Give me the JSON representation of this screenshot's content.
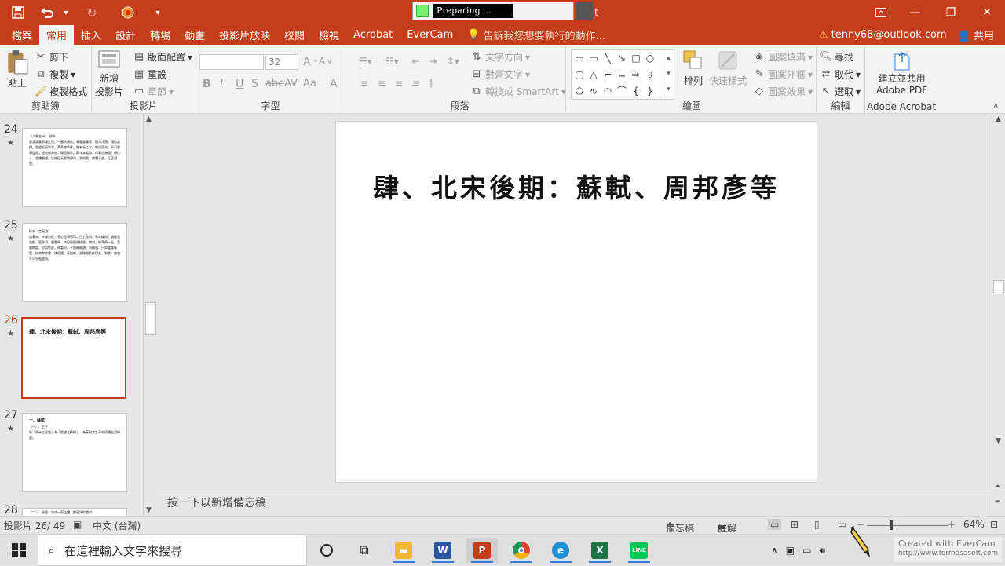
{
  "qat": {
    "save_icon": "save-icon",
    "undo_icon": "undo-icon",
    "redo_icon": "redo-icon"
  },
  "preparing": {
    "text": "Preparing ..."
  },
  "title_suffix": "t",
  "tabs": [
    {
      "label": "檔案"
    },
    {
      "label": "常用"
    },
    {
      "label": "插入"
    },
    {
      "label": "設計"
    },
    {
      "label": "轉場"
    },
    {
      "label": "動畫"
    },
    {
      "label": "投影片放映"
    },
    {
      "label": "校閱"
    },
    {
      "label": "檢視"
    },
    {
      "label": "Acrobat"
    },
    {
      "label": "EverCam"
    }
  ],
  "tell_me": "告訴我您想要執行的動作...",
  "account": {
    "email": "tenny68@outlook.com",
    "share": "共用"
  },
  "ribbon": {
    "clipboard": {
      "label": "剪貼簿",
      "paste": "貼上",
      "cut": "剪下",
      "copy": "複製",
      "format_painter": "複製格式"
    },
    "slides": {
      "label": "投影片",
      "new_slide_1": "新增",
      "new_slide_2": "投影片",
      "layout": "版面配置",
      "reset": "重設",
      "section": "章節"
    },
    "font": {
      "label": "字型",
      "font_size": "32"
    },
    "paragraph": {
      "label": "段落",
      "text_direction": "文字方向",
      "align_text": "對齊文字",
      "smartart": "轉換成 SmartArt"
    },
    "drawing": {
      "label": "繪圖",
      "arrange": "排列",
      "quick_styles": "快速樣式",
      "shape_fill": "圖案填滿",
      "shape_outline": "圖案外框",
      "shape_effects": "圖案效果"
    },
    "editing": {
      "label": "編輯",
      "find": "尋找",
      "replace": "取代",
      "select": "選取"
    },
    "acrobat": {
      "label": "Adobe Acrobat",
      "create_1": "建立並共用",
      "create_2": "Adobe PDF"
    }
  },
  "thumbnails": [
    {
      "num": "24",
      "title": "",
      "text": "〔八聲甘州〕　柳永\n對瀟瀟暮雨灑江天，一番洗清秋。漸霜風淒緊，關河冷落，殘照當樓。是處紅衰翠減，苒苒物華休。惟有長江水，無語東流。不忍登高臨遠，望故鄉渺邈，歸思難收。歎年來蹤跡，何事苦淹留？想佳人、妝樓顒望，誤幾回天際識歸舟。爭知我，倚闌干處，正恁凝愁。"
    },
    {
      "num": "25",
      "title": "",
      "text": "柳永〈定風波〉\n自春來、慘綠愁紅，芳心是事可可。日上花梢，鶯穿柳帶，猶壓香衾臥。暖酥消，膩雲嚲。終日厭厭倦梳裹。無那。恨薄情一去，音書無箇。早知恁麼，悔當初、不把雕鞍鎖。向雞窗、只與蠻箋象管，拘束教吟課。鎮相隨，莫拋躲。針線閒拈伴伊坐。和我，免使年少光陰虛過。"
    },
    {
      "num": "26",
      "title": "肆、北宋後期：蘇軾、周邦彥等",
      "text": ""
    },
    {
      "num": "27",
      "title": "一、蘇軾",
      "text": "（一）、生平\n與「黃州之息處」為「超越之精神」，為蘇軾其生平的兩種主要轉變。"
    },
    {
      "num": "28",
      "title": "",
      "text": "（二）、風格：自成一家之體，擴展詞的題材..."
    }
  ],
  "slide": {
    "title": "肆、北宋後期：蘇軾、周邦彥等"
  },
  "notes_placeholder": "按一下以新增備忘稿",
  "status": {
    "slide_counter": "投影片 26/ 49",
    "language": "中文 (台灣)",
    "notes": "備忘稿",
    "comments": "註解",
    "zoom": "64%"
  },
  "taskbar": {
    "search_placeholder": "在這裡輸入文字來搜尋"
  },
  "watermark": {
    "line1": "Created with EverCam",
    "line2": "http://www.formosasoft.com"
  },
  "colors": {
    "accent": "#c43e1c",
    "ribbon_bg": "#f3f3f3",
    "pane_bg": "#e6e6e6"
  }
}
